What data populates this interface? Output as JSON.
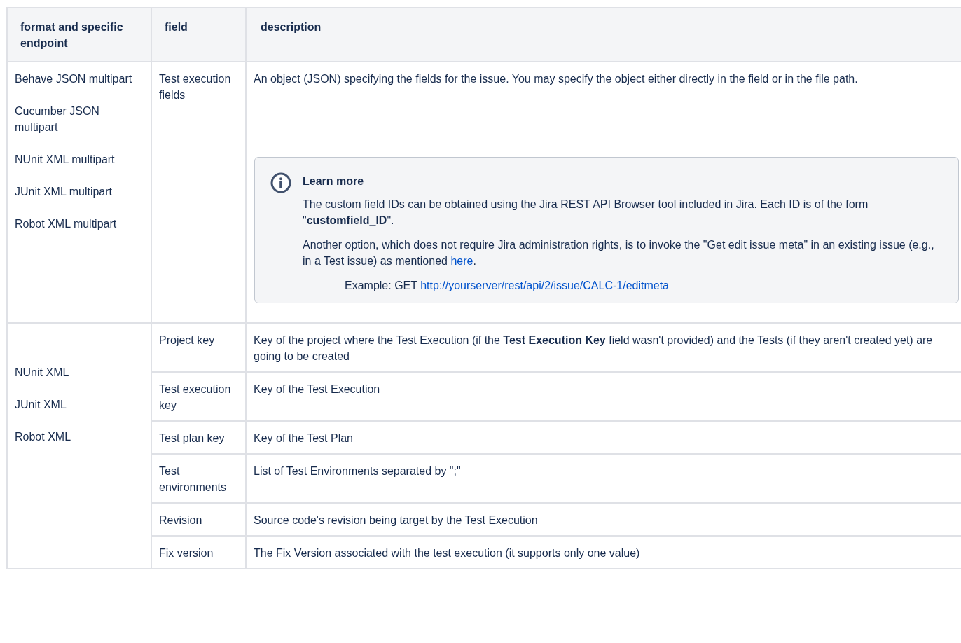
{
  "table": {
    "columns": [
      "format and specific endpoint",
      "field",
      "description"
    ],
    "groups": [
      {
        "formats": [
          "Behave JSON multipart",
          "Cucumber JSON multipart",
          "NUnit XML multipart",
          "JUnit XML multipart",
          "Robot XML multipart"
        ],
        "rows": [
          {
            "field": "Test execution fields",
            "description": "An object (JSON) specifying the fields for the issue. You may specify the object either directly in the field or in the file path.",
            "info_panel": {
              "title": "Learn more",
              "paragraphs": [
                {
                  "text": "The custom field IDs can be obtained using the Jira REST API Browser tool included in Jira. Each ID is of the form \"**customfield_ID**\"."
                },
                {
                  "text": "Another option, which does not require Jira administration rights, is to invoke the \"Get edit issue meta\" in an existing issue (e.g., in a Test issue) as mentioned ",
                  "link": "here",
                  "after": "."
                }
              ],
              "example": {
                "text": "Example: GET ",
                "link": "http://yourserver/rest/api/2/issue/CALC-1/editmeta"
              }
            }
          }
        ]
      },
      {
        "formats": [
          "NUnit XML",
          "JUnit XML",
          "Robot XML"
        ],
        "rows": [
          {
            "field": "Project key",
            "description": "Key of the project where the Test Execution (if the **Test Execution Key** field wasn't provided) and the Tests (if they aren't created yet) are going to be created"
          },
          {
            "field": "Test execution key",
            "description": "Key of the Test Execution"
          },
          {
            "field": "Test plan key",
            "description": "Key of the Test Plan"
          },
          {
            "field": "Test environments",
            "description": "List of Test Environments separated by \";\""
          },
          {
            "field": "Revision",
            "description": "Source code's revision being target by the Test Execution"
          },
          {
            "field": "Fix version",
            "description": "The Fix Version associated with the test execution (it supports only one value)"
          }
        ]
      }
    ]
  }
}
